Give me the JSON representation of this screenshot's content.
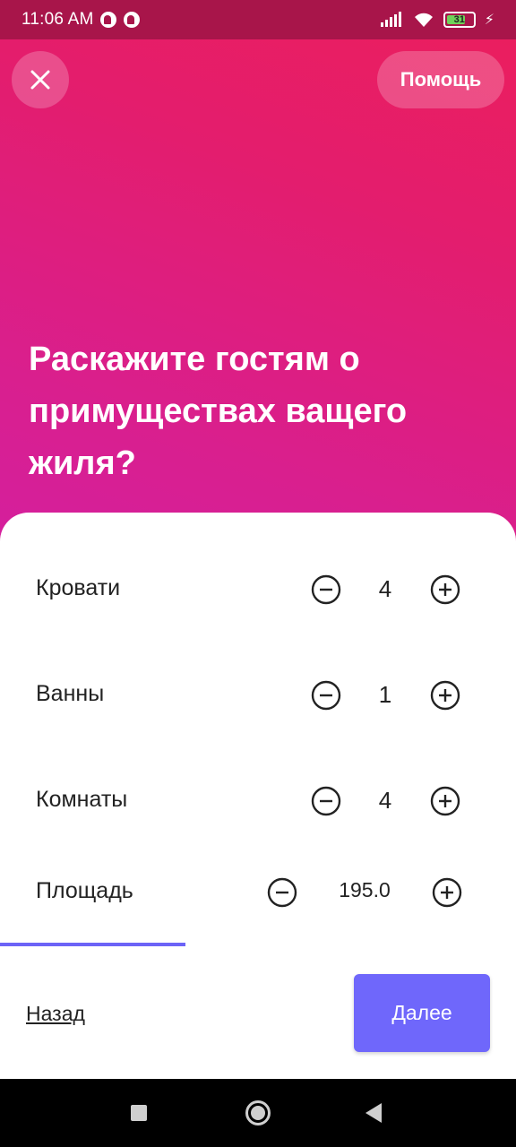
{
  "status_bar": {
    "time": "11:06 AM",
    "battery": "31"
  },
  "header": {
    "close_icon": "close-icon",
    "help_label": "Помощь"
  },
  "title": "Раскажите гостям о примуществах ващего жиля?",
  "counters": [
    {
      "label": "Кровати",
      "value": "4"
    },
    {
      "label": "Ванны",
      "value": "1"
    },
    {
      "label": "Комнаты",
      "value": "4"
    },
    {
      "label": "Площадь",
      "value": "195.0"
    }
  ],
  "progress": 0.36,
  "footer": {
    "back_label": "Назад",
    "next_label": "Далее"
  },
  "colors": {
    "accent": "#6f67fb",
    "gradient_top": "#ec1e5c",
    "gradient_bottom": "#d41f9e"
  }
}
